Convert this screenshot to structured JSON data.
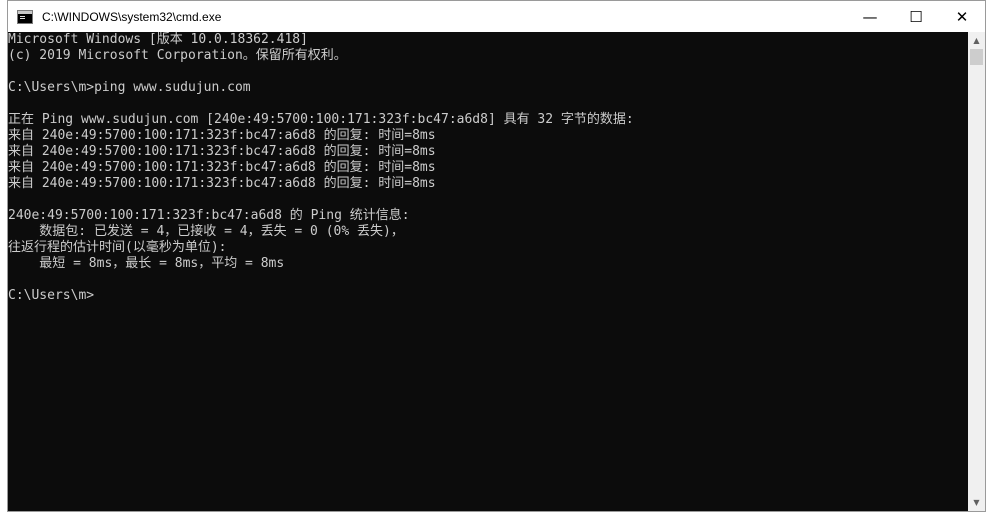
{
  "window": {
    "title": "C:\\WINDOWS\\system32\\cmd.exe",
    "icon": "cmd-icon",
    "controls": {
      "minimize": "—",
      "maximize": "☐",
      "close": "✕"
    }
  },
  "terminal": {
    "lines": [
      "Microsoft Windows [版本 10.0.18362.418]",
      "(c) 2019 Microsoft Corporation。保留所有权利。",
      "",
      "C:\\Users\\m>ping www.sudujun.com",
      "",
      "正在 Ping www.sudujun.com [240e:49:5700:100:171:323f:bc47:a6d8] 具有 32 字节的数据:",
      "来自 240e:49:5700:100:171:323f:bc47:a6d8 的回复: 时间=8ms",
      "来自 240e:49:5700:100:171:323f:bc47:a6d8 的回复: 时间=8ms",
      "来自 240e:49:5700:100:171:323f:bc47:a6d8 的回复: 时间=8ms",
      "来自 240e:49:5700:100:171:323f:bc47:a6d8 的回复: 时间=8ms",
      "",
      "240e:49:5700:100:171:323f:bc47:a6d8 的 Ping 统计信息:",
      "    数据包: 已发送 = 4，已接收 = 4，丢失 = 0 (0% 丢失)，",
      "往返行程的估计时间(以毫秒为单位):",
      "    最短 = 8ms，最长 = 8ms，平均 = 8ms",
      "",
      "C:\\Users\\m>"
    ],
    "text_color": "#cccccc",
    "background_color": "#0c0c0c"
  },
  "scrollbar": {
    "up_arrow": "▲",
    "down_arrow": "▼"
  }
}
